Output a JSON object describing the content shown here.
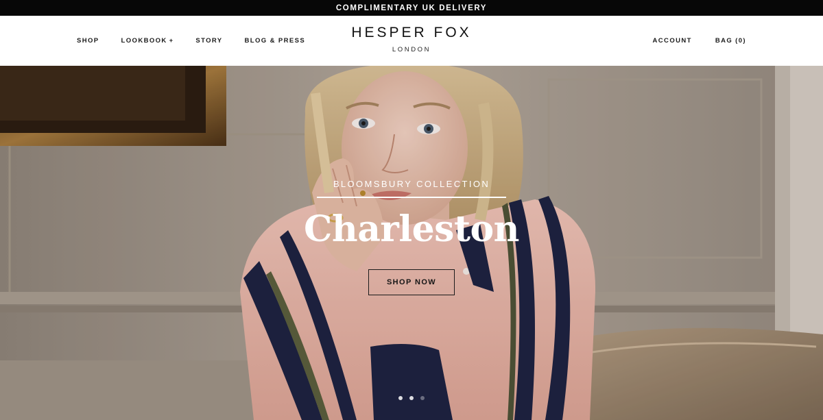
{
  "announcement": {
    "text": "COMPLIMENTARY UK DELIVERY"
  },
  "header": {
    "nav_left": [
      {
        "label": "SHOP"
      },
      {
        "label": "LOOKBOOK",
        "has_dropdown": true,
        "caret": "+"
      },
      {
        "label": "STORY"
      },
      {
        "label": "BLOG & PRESS"
      }
    ],
    "logo": {
      "name": "HESPER FOX",
      "sub": "LONDON"
    },
    "nav_right": [
      {
        "label": "ACCOUNT"
      },
      {
        "label": "BAG (0)"
      }
    ]
  },
  "hero": {
    "eyebrow": "BLOOMSBURY COLLECTION",
    "headline": "Charleston",
    "cta_label": "SHOP NOW",
    "slides": {
      "count": 3,
      "active": 1
    }
  },
  "colors": {
    "announcement_bg": "#070707",
    "text_white": "#ffffff",
    "text_dark": "#111111",
    "blouse_pink": "#e8b5ab",
    "stripe_navy": "#1c2140"
  }
}
